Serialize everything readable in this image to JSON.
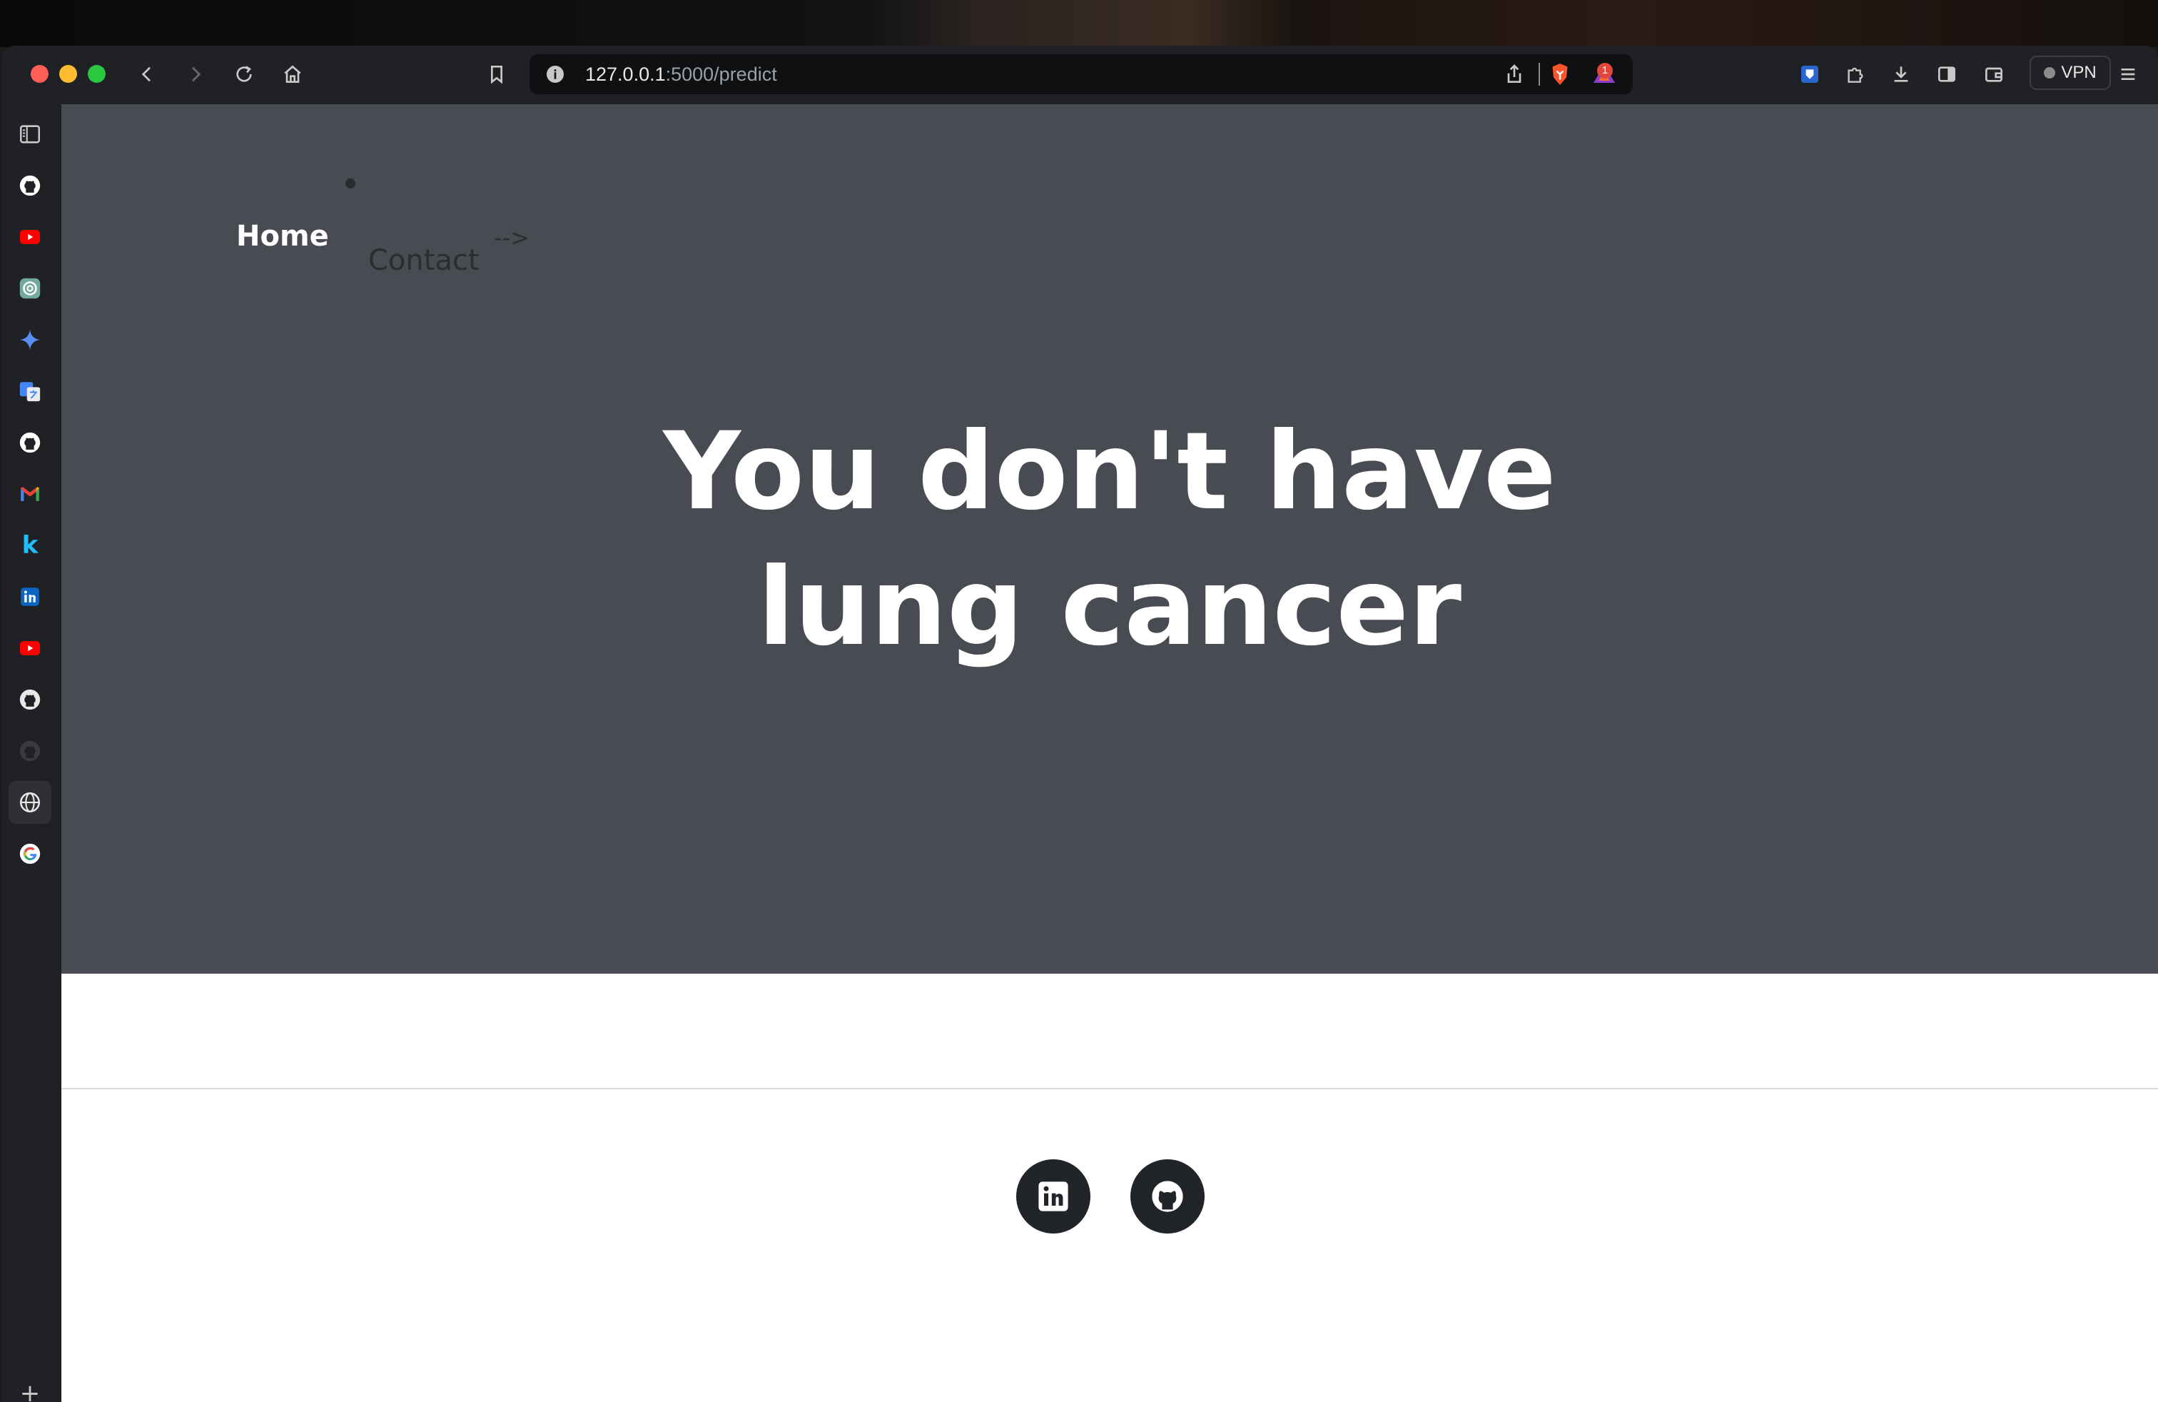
{
  "browser": {
    "url_host": "127.0.0.1",
    "url_path": ":5000/predict",
    "vpn_label": "VPN",
    "notification_count": "1"
  },
  "sidebar": {
    "items": [
      {
        "name": "sidebar-toggle",
        "icon": "sidebar-panel-icon"
      },
      {
        "name": "github",
        "icon": "github-icon"
      },
      {
        "name": "youtube",
        "icon": "youtube-icon"
      },
      {
        "name": "chatgpt",
        "icon": "chatgpt-icon"
      },
      {
        "name": "gemini",
        "icon": "gemini-icon"
      },
      {
        "name": "google-translate",
        "icon": "translate-icon"
      },
      {
        "name": "github-2",
        "icon": "github-icon"
      },
      {
        "name": "gmail",
        "icon": "gmail-icon"
      },
      {
        "name": "kaggle",
        "icon": "kaggle-icon",
        "glyph": "k"
      },
      {
        "name": "linkedin",
        "icon": "linkedin-icon"
      },
      {
        "name": "youtube-2",
        "icon": "youtube-icon"
      },
      {
        "name": "github-3",
        "icon": "github-icon"
      },
      {
        "name": "github-4",
        "icon": "github-icon"
      },
      {
        "name": "web",
        "icon": "globe-icon"
      },
      {
        "name": "google",
        "icon": "google-icon"
      },
      {
        "name": "add",
        "icon": "plus-icon",
        "glyph": "+"
      }
    ]
  },
  "nav": {
    "home": "Home",
    "contact": "Contact",
    "stray_text": "-->"
  },
  "hero": {
    "line1": "You don't have",
    "line2": "lung cancer"
  },
  "footer": {
    "social": [
      {
        "name": "linkedin",
        "icon": "linkedin-icon"
      },
      {
        "name": "github",
        "icon": "github-icon"
      }
    ]
  },
  "colors": {
    "hero_bg": "#494b53",
    "social_bg": "#212529",
    "browser_chrome": "#202124"
  }
}
